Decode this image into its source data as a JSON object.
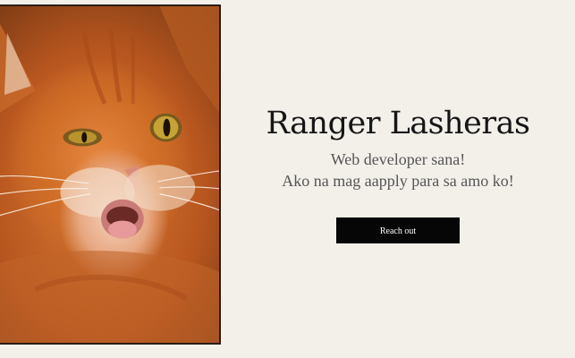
{
  "profile": {
    "name": "Ranger Lasheras",
    "tagline_line1": "Web developer sana!",
    "tagline_line2": "Ako na mag aapply para sa amo ko!",
    "cta_label": "Reach out"
  },
  "colors": {
    "background": "#f3f0ea",
    "button": "#060606",
    "button_text": "#ffffff",
    "heading": "#161616",
    "tagline": "#555555"
  }
}
